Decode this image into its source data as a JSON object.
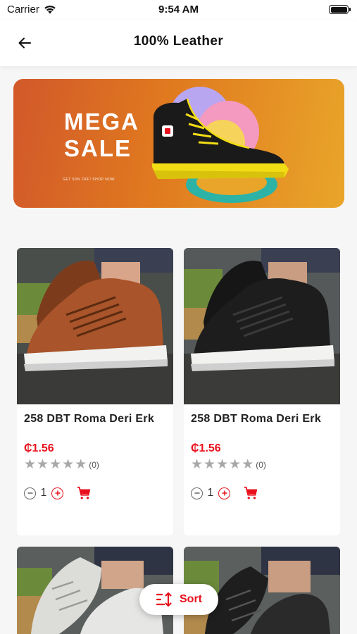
{
  "status_bar": {
    "carrier": "Carrier",
    "time": "9:54 AM"
  },
  "header": {
    "title": "100% Leather",
    "back_icon": "arrow-left-icon"
  },
  "banner": {
    "title_line1": "MEGA",
    "title_line2": "SALE",
    "subtitle": "GET 50% OFF! SHOP NOW"
  },
  "products": [
    {
      "name": "258 DBT Roma Deri Erk",
      "price": "₵1.56",
      "rating": 0,
      "review_count": "(0)",
      "quantity": "1",
      "shoe_color": "#a9542a"
    },
    {
      "name": "258 DBT Roma Deri Erk",
      "price": "₵1.56",
      "rating": 0,
      "review_count": "(0)",
      "quantity": "1",
      "shoe_color": "#1d1d1d"
    },
    {
      "shoe_color": "#e6e6e4"
    },
    {
      "shoe_color": "#2a2a2a"
    }
  ],
  "sort_button": {
    "label": "Sort",
    "icon": "sort-icon"
  },
  "colors": {
    "accent": "#e8101c",
    "banner_start": "#d2582a",
    "banner_end": "#e9a52a"
  }
}
